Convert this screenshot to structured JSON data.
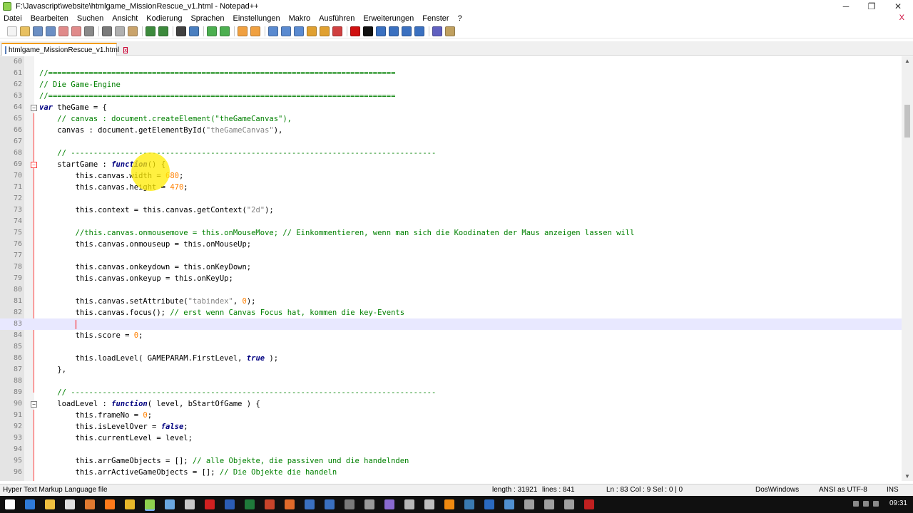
{
  "window": {
    "title": "F:\\Javascript\\website\\htmlgame_MissionRescue_v1.html - Notepad++",
    "minimize": "─",
    "restore": "❐",
    "close": "✕"
  },
  "menu": [
    "Datei",
    "Bearbeiten",
    "Suchen",
    "Ansicht",
    "Kodierung",
    "Sprachen",
    "Einstellungen",
    "Makro",
    "Ausführen",
    "Erweiterungen",
    "Fenster",
    "?"
  ],
  "menu_close": "X",
  "toolbar_icons": [
    {
      "name": "new-file-icon",
      "color": "#f4f4f4"
    },
    {
      "name": "open-file-icon",
      "color": "#e8c060"
    },
    {
      "name": "save-icon",
      "color": "#6b8fc4"
    },
    {
      "name": "save-all-icon",
      "color": "#6b8fc4"
    },
    {
      "name": "close-icon",
      "color": "#e08a8a"
    },
    {
      "name": "close-all-icon",
      "color": "#e08a8a"
    },
    {
      "name": "print-icon",
      "color": "#8a8a8a"
    },
    {
      "sep": true
    },
    {
      "name": "cut-icon",
      "color": "#7a7a7a"
    },
    {
      "name": "copy-icon",
      "color": "#b0b0b0"
    },
    {
      "name": "paste-icon",
      "color": "#c9a36b"
    },
    {
      "sep": true
    },
    {
      "name": "undo-icon",
      "color": "#3c8a3c"
    },
    {
      "name": "redo-icon",
      "color": "#3c8a3c"
    },
    {
      "sep": true
    },
    {
      "name": "find-icon",
      "color": "#404040"
    },
    {
      "name": "replace-icon",
      "color": "#4a7fc0"
    },
    {
      "sep": true
    },
    {
      "name": "zoom-in-icon",
      "color": "#4caf50"
    },
    {
      "name": "zoom-out-icon",
      "color": "#4caf50"
    },
    {
      "sep": true
    },
    {
      "name": "sync-v-icon",
      "color": "#f0a040"
    },
    {
      "name": "sync-h-icon",
      "color": "#f0a040"
    },
    {
      "sep": true
    },
    {
      "name": "wrap-icon",
      "color": "#5a8ad0"
    },
    {
      "name": "show-all-icon",
      "color": "#5a8ad0"
    },
    {
      "name": "indent-guide-icon",
      "color": "#5a8ad0"
    },
    {
      "name": "lang-icon",
      "color": "#e0a030"
    },
    {
      "name": "doc-map-icon",
      "color": "#e0a030"
    },
    {
      "name": "func-list-icon",
      "color": "#d04040"
    },
    {
      "sep": true
    },
    {
      "name": "record-macro-icon",
      "color": "#d01010"
    },
    {
      "name": "stop-macro-icon",
      "color": "#101010"
    },
    {
      "name": "play-macro-icon",
      "color": "#3a70c0"
    },
    {
      "name": "run-macro-icon",
      "color": "#3a70c0"
    },
    {
      "name": "save-macro-icon",
      "color": "#3a70c0"
    },
    {
      "name": "trim-macro-icon",
      "color": "#3a70c0"
    },
    {
      "sep": true
    },
    {
      "name": "spellcheck-icon",
      "color": "#6060c0"
    },
    {
      "name": "plugin-icon",
      "color": "#c0a060"
    }
  ],
  "tab": {
    "label": "htmlgame_MissionRescue_v1.html",
    "close": "x"
  },
  "code_lines": [
    {
      "n": "60",
      "fold": "",
      "tokens": []
    },
    {
      "n": "61",
      "fold": "",
      "tokens": [
        {
          "t": "//=============================================================================",
          "c": "cmt"
        }
      ]
    },
    {
      "n": "62",
      "fold": "",
      "tokens": [
        {
          "t": "// Die Game-Engine",
          "c": "cmt"
        }
      ]
    },
    {
      "n": "63",
      "fold": "",
      "tokens": [
        {
          "t": "//=============================================================================",
          "c": "cmt"
        }
      ]
    },
    {
      "n": "64",
      "fold": "⊟",
      "tokens": [
        {
          "t": "var",
          "c": "kw"
        },
        {
          "t": " theGame = {",
          "c": "pl"
        }
      ]
    },
    {
      "n": "65",
      "fold": "",
      "tokens": [
        {
          "t": "    // canvas : document.createElement(\"theGameCanvas\"),",
          "c": "cmt"
        }
      ]
    },
    {
      "n": "66",
      "fold": "",
      "tokens": [
        {
          "t": "    canvas : document.getElementById(",
          "c": "pl"
        },
        {
          "t": "\"theGameCanvas\"",
          "c": "str"
        },
        {
          "t": "),",
          "c": "pl"
        }
      ]
    },
    {
      "n": "67",
      "fold": "",
      "tokens": []
    },
    {
      "n": "68",
      "fold": "",
      "tokens": [
        {
          "t": "    // ---------------------------------------------------------------------------------",
          "c": "cmt"
        }
      ]
    },
    {
      "n": "69",
      "fold": "⊟",
      "red": true,
      "tokens": [
        {
          "t": "    startGame : ",
          "c": "pl"
        },
        {
          "t": "function",
          "c": "kw"
        },
        {
          "t": "() {",
          "c": "pl"
        }
      ]
    },
    {
      "n": "70",
      "fold": "",
      "tokens": [
        {
          "t": "        this.canvas.width = ",
          "c": "pl"
        },
        {
          "t": "680",
          "c": "num"
        },
        {
          "t": ";",
          "c": "pl"
        }
      ]
    },
    {
      "n": "71",
      "fold": "",
      "tokens": [
        {
          "t": "        this.canvas.height = ",
          "c": "pl"
        },
        {
          "t": "470",
          "c": "num"
        },
        {
          "t": ";",
          "c": "pl"
        }
      ]
    },
    {
      "n": "72",
      "fold": "",
      "tokens": []
    },
    {
      "n": "73",
      "fold": "",
      "tokens": [
        {
          "t": "        this.context = this.canvas.getContext(",
          "c": "pl"
        },
        {
          "t": "\"2d\"",
          "c": "str"
        },
        {
          "t": ");",
          "c": "pl"
        }
      ]
    },
    {
      "n": "74",
      "fold": "",
      "tokens": []
    },
    {
      "n": "75",
      "fold": "",
      "tokens": [
        {
          "t": "        //this.canvas.onmousemove = this.onMouseMove; // Einkommentieren, wenn man sich die Koodinaten der Maus anzeigen lassen will",
          "c": "cmt"
        }
      ]
    },
    {
      "n": "76",
      "fold": "",
      "tokens": [
        {
          "t": "        this.canvas.onmouseup = this.onMouseUp;",
          "c": "pl"
        }
      ]
    },
    {
      "n": "77",
      "fold": "",
      "tokens": []
    },
    {
      "n": "78",
      "fold": "",
      "tokens": [
        {
          "t": "        this.canvas.onkeydown = this.onKeyDown;",
          "c": "pl"
        }
      ]
    },
    {
      "n": "79",
      "fold": "",
      "tokens": [
        {
          "t": "        this.canvas.onkeyup = this.onKeyUp;",
          "c": "pl"
        }
      ]
    },
    {
      "n": "80",
      "fold": "",
      "tokens": []
    },
    {
      "n": "81",
      "fold": "",
      "tokens": [
        {
          "t": "        this.canvas.setAttribute(",
          "c": "pl"
        },
        {
          "t": "\"tabindex\"",
          "c": "str"
        },
        {
          "t": ", ",
          "c": "pl"
        },
        {
          "t": "0",
          "c": "num"
        },
        {
          "t": ");",
          "c": "pl"
        }
      ]
    },
    {
      "n": "82",
      "fold": "",
      "tokens": [
        {
          "t": "        this.canvas.focus(); ",
          "c": "pl"
        },
        {
          "t": "// erst wenn Canvas Focus hat, kommen die key-Events",
          "c": "cmt"
        }
      ]
    },
    {
      "n": "83",
      "fold": "",
      "current": true,
      "tokens": [
        {
          "t": "        ",
          "c": "pl"
        }
      ]
    },
    {
      "n": "84",
      "fold": "",
      "tokens": [
        {
          "t": "        this.score = ",
          "c": "pl"
        },
        {
          "t": "0",
          "c": "num"
        },
        {
          "t": ";",
          "c": "pl"
        }
      ]
    },
    {
      "n": "85",
      "fold": "",
      "tokens": []
    },
    {
      "n": "86",
      "fold": "",
      "tokens": [
        {
          "t": "        this.loadLevel( GAMEPARAM.FirstLevel, ",
          "c": "pl"
        },
        {
          "t": "true",
          "c": "kw"
        },
        {
          "t": " );",
          "c": "pl"
        }
      ]
    },
    {
      "n": "87",
      "fold": "",
      "tokens": [
        {
          "t": "    },",
          "c": "pl"
        }
      ]
    },
    {
      "n": "88",
      "fold": "",
      "tokens": []
    },
    {
      "n": "89",
      "fold": "",
      "tokens": [
        {
          "t": "    // ---------------------------------------------------------------------------------",
          "c": "cmt"
        }
      ]
    },
    {
      "n": "90",
      "fold": "⊟",
      "tokens": [
        {
          "t": "    loadLevel : ",
          "c": "pl"
        },
        {
          "t": "function",
          "c": "kw"
        },
        {
          "t": "( level, bStartOfGame ) {",
          "c": "pl"
        }
      ]
    },
    {
      "n": "91",
      "fold": "",
      "tokens": [
        {
          "t": "        this.frameNo = ",
          "c": "pl"
        },
        {
          "t": "0",
          "c": "num"
        },
        {
          "t": ";",
          "c": "pl"
        }
      ]
    },
    {
      "n": "92",
      "fold": "",
      "tokens": [
        {
          "t": "        this.isLevelOver = ",
          "c": "pl"
        },
        {
          "t": "false",
          "c": "kw"
        },
        {
          "t": ";",
          "c": "pl"
        }
      ]
    },
    {
      "n": "93",
      "fold": "",
      "tokens": [
        {
          "t": "        this.currentLevel = level;",
          "c": "pl"
        }
      ]
    },
    {
      "n": "94",
      "fold": "",
      "tokens": []
    },
    {
      "n": "95",
      "fold": "",
      "tokens": [
        {
          "t": "        this.arrGameObjects = []; ",
          "c": "pl"
        },
        {
          "t": "// alle Objekte, die passiven und die handelnden",
          "c": "cmt"
        }
      ]
    },
    {
      "n": "96",
      "fold": "",
      "tokens": [
        {
          "t": "        this.arrActiveGameObjects = []; ",
          "c": "pl"
        },
        {
          "t": "// Die Objekte die handeln",
          "c": "cmt"
        }
      ]
    }
  ],
  "status": {
    "filetype": "Hyper Text Markup Language file",
    "length": "length : 31921",
    "lines": "lines : 841",
    "position": "Ln : 83    Col : 9    Sel : 0 | 0",
    "eol": "Dos\\Windows",
    "encoding": "ANSI as UTF-8",
    "mode": "INS"
  },
  "taskbar": {
    "clock": "09:31",
    "icons": [
      {
        "name": "start-icon",
        "color": "#ffffff"
      },
      {
        "name": "edge-icon",
        "color": "#2f7bd8"
      },
      {
        "name": "explorer-icon",
        "color": "#f0c040"
      },
      {
        "name": "store-icon",
        "color": "#e0e0e0"
      },
      {
        "name": "paint-icon",
        "color": "#e07a30"
      },
      {
        "name": "firefox-icon",
        "color": "#ff7a1a"
      },
      {
        "name": "chrome-icon",
        "color": "#e8b82a"
      },
      {
        "name": "notepadpp-icon",
        "color": "#8fd14f",
        "active": true
      },
      {
        "name": "app-icon-9",
        "color": "#6aa7e0"
      },
      {
        "name": "app-icon-10",
        "color": "#c8c8c8"
      },
      {
        "name": "acrobat-icon",
        "color": "#d02020"
      },
      {
        "name": "word-icon",
        "color": "#2b5cb4"
      },
      {
        "name": "excel-icon",
        "color": "#1f7a3a"
      },
      {
        "name": "powerpoint-icon",
        "color": "#c8442a"
      },
      {
        "name": "app-icon-15",
        "color": "#e06a2a"
      },
      {
        "name": "app-icon-16",
        "color": "#3a70c0"
      },
      {
        "name": "app-icon-17",
        "color": "#3a70c0"
      },
      {
        "name": "app-icon-18",
        "color": "#7a7a7a"
      },
      {
        "name": "app-icon-19",
        "color": "#9a9a9a"
      },
      {
        "name": "app-icon-20",
        "color": "#8a6ad0"
      },
      {
        "name": "app-icon-21",
        "color": "#b8b8b8"
      },
      {
        "name": "app-icon-22",
        "color": "#c0c0c0"
      },
      {
        "name": "vlc-icon",
        "color": "#f08a10"
      },
      {
        "name": "lightroom-icon",
        "color": "#3a7ab0"
      },
      {
        "name": "photoshop-icon",
        "color": "#2a6ac0"
      },
      {
        "name": "app-icon-26",
        "color": "#5090d0"
      },
      {
        "name": "app-icon-27",
        "color": "#a0a0a0"
      },
      {
        "name": "app-icon-28",
        "color": "#a0a0a0"
      },
      {
        "name": "app-icon-29",
        "color": "#a0a0a0"
      },
      {
        "name": "filezilla-icon",
        "color": "#c02020"
      }
    ]
  }
}
